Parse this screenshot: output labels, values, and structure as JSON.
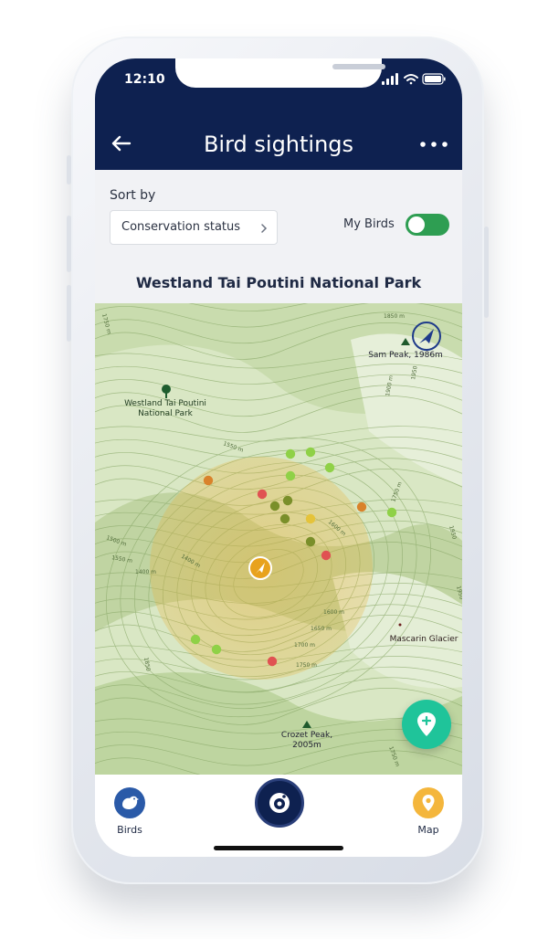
{
  "status_bar": {
    "time": "12:10"
  },
  "header": {
    "title": "Bird sightings"
  },
  "sort": {
    "label": "Sort by",
    "selected": "Conservation status",
    "my_birds_label": "My Birds",
    "my_birds_on": true
  },
  "park_title": "Westland Tai Poutini National Park",
  "map": {
    "labels": {
      "park": [
        "Westland Tai Poutini",
        "National Park"
      ],
      "sam_peak": "Sam Peak, 1986m",
      "mascarin": "Mascarin Glacier",
      "crozet": [
        "Crozet Peak,",
        "2005m"
      ],
      "contours": [
        "1850 m",
        "1950",
        "1900 m",
        "1550 m",
        "1600 m",
        "1750 m",
        "1950",
        "1500 m",
        "1550 m",
        "1400 m",
        "1400 m",
        "1600 m",
        "1650 m",
        "1700 m",
        "1750 m",
        "1850",
        "1750 m",
        "1950",
        "1750 m"
      ]
    },
    "colors": {
      "critical": "#e05252",
      "endangered": "#d9822b",
      "vulnerable": "#e5c33a",
      "near_threatened": "#7a8f2a",
      "least_concern": "#8fd147"
    }
  },
  "bottom_nav": {
    "birds_label": "Birds",
    "map_label": "Map"
  },
  "icons": [
    "back-arrow-icon",
    "more-dots-icon",
    "chevron-right-icon",
    "compass-icon",
    "park-tree-icon",
    "peak-icon",
    "location-arrow-icon",
    "bird-icon",
    "camera-icon",
    "map-pin-icon",
    "add-pin-icon"
  ]
}
